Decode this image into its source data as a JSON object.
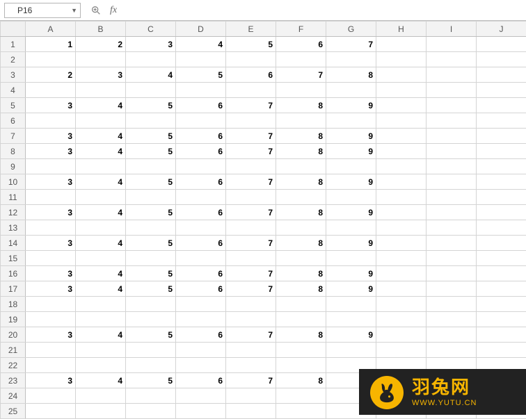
{
  "formula_bar": {
    "cell_ref": "P16",
    "formula_value": ""
  },
  "columns": [
    "A",
    "B",
    "C",
    "D",
    "E",
    "F",
    "G",
    "H",
    "I",
    "J"
  ],
  "row_count": 25,
  "active_row": 16,
  "cells": {
    "1": {
      "A": "1",
      "B": "2",
      "C": "3",
      "D": "4",
      "E": "5",
      "F": "6",
      "G": "7"
    },
    "3": {
      "A": "2",
      "B": "3",
      "C": "4",
      "D": "5",
      "E": "6",
      "F": "7",
      "G": "8"
    },
    "5": {
      "A": "3",
      "B": "4",
      "C": "5",
      "D": "6",
      "E": "7",
      "F": "8",
      "G": "9"
    },
    "7": {
      "A": "3",
      "B": "4",
      "C": "5",
      "D": "6",
      "E": "7",
      "F": "8",
      "G": "9"
    },
    "8": {
      "A": "3",
      "B": "4",
      "C": "5",
      "D": "6",
      "E": "7",
      "F": "8",
      "G": "9"
    },
    "10": {
      "A": "3",
      "B": "4",
      "C": "5",
      "D": "6",
      "E": "7",
      "F": "8",
      "G": "9"
    },
    "12": {
      "A": "3",
      "B": "4",
      "C": "5",
      "D": "6",
      "E": "7",
      "F": "8",
      "G": "9"
    },
    "14": {
      "A": "3",
      "B": "4",
      "C": "5",
      "D": "6",
      "E": "7",
      "F": "8",
      "G": "9"
    },
    "16": {
      "A": "3",
      "B": "4",
      "C": "5",
      "D": "6",
      "E": "7",
      "F": "8",
      "G": "9"
    },
    "17": {
      "A": "3",
      "B": "4",
      "C": "5",
      "D": "6",
      "E": "7",
      "F": "8",
      "G": "9"
    },
    "20": {
      "A": "3",
      "B": "4",
      "C": "5",
      "D": "6",
      "E": "7",
      "F": "8",
      "G": "9"
    },
    "23": {
      "A": "3",
      "B": "4",
      "C": "5",
      "D": "6",
      "E": "7",
      "F": "8"
    }
  },
  "watermark": {
    "title": "羽兔网",
    "url": "WWW.YUTU.CN"
  }
}
